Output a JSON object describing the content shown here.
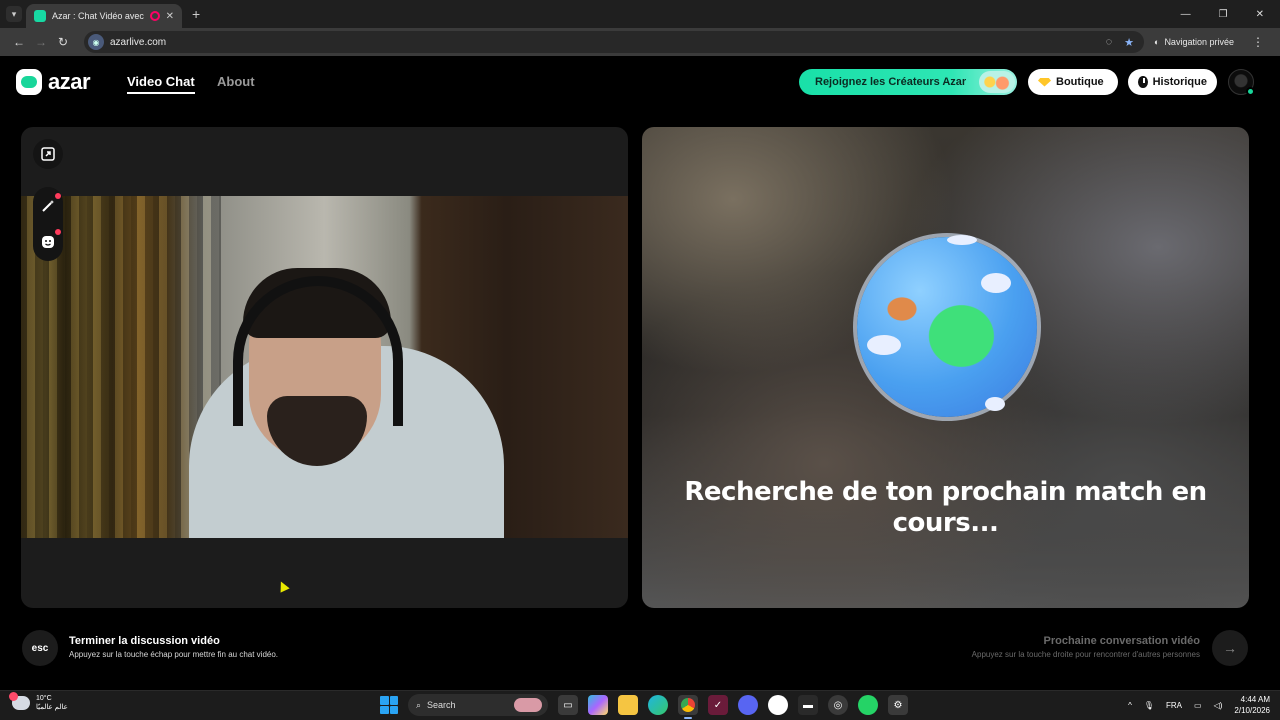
{
  "browser": {
    "tab_title": "Azar : Chat Vidéo avec de n",
    "url": "azarlive.com",
    "private_label": "Navigation privée"
  },
  "header": {
    "logo_text": "azar",
    "nav": [
      {
        "label": "Video Chat",
        "active": true
      },
      {
        "label": "About",
        "active": false
      }
    ],
    "creators_button": "Rejoignez les Créateurs Azar",
    "boutique_button": "Boutique",
    "historique_button": "Historique"
  },
  "remote_panel": {
    "status_text": "Recherche de ton prochain match en cours..."
  },
  "footer": {
    "esc_key": "esc",
    "end_title": "Terminer la discussion vidéo",
    "end_subtitle": "Appuyez sur la touche échap pour mettre fin au chat vidéo.",
    "next_title": "Prochaine conversation vidéo",
    "next_subtitle": "Appuyez sur la touche droite pour rencontrer d'autres personnes"
  },
  "taskbar": {
    "temperature": "10°C",
    "weather_caption": "عالم عالميًا",
    "search_label": "Search",
    "language": "FRA",
    "time": "4:44 AM",
    "date": "2/10/2026"
  },
  "colors": {
    "brand_green": "#19d69a",
    "boutique_diamond": "#ffc629"
  },
  "icons": [
    "expand-icon",
    "magic-wand-icon",
    "face-filter-icon",
    "arrow-right-icon",
    "clock-icon",
    "diamond-icon"
  ]
}
